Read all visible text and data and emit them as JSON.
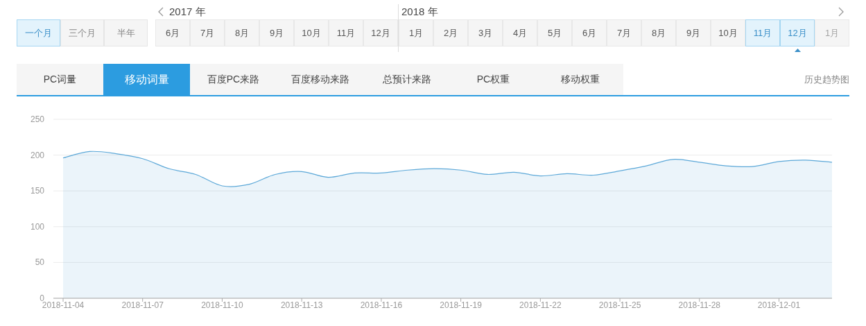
{
  "periods": [
    {
      "label": "一个月",
      "selected": true
    },
    {
      "label": "三个月",
      "selected": false
    },
    {
      "label": "半年",
      "selected": false
    }
  ],
  "year_groups": [
    {
      "year": "2017 年",
      "months": [
        {
          "label": "6月",
          "selected": false,
          "disabled": false
        },
        {
          "label": "7月",
          "selected": false,
          "disabled": false
        },
        {
          "label": "8月",
          "selected": false,
          "disabled": false
        },
        {
          "label": "9月",
          "selected": false,
          "disabled": false
        },
        {
          "label": "10月",
          "selected": false,
          "disabled": false
        },
        {
          "label": "11月",
          "selected": false,
          "disabled": false
        },
        {
          "label": "12月",
          "selected": false,
          "disabled": false
        }
      ]
    },
    {
      "year": "2018 年",
      "months": [
        {
          "label": "1月",
          "selected": false,
          "disabled": false
        },
        {
          "label": "2月",
          "selected": false,
          "disabled": false
        },
        {
          "label": "3月",
          "selected": false,
          "disabled": false
        },
        {
          "label": "4月",
          "selected": false,
          "disabled": false
        },
        {
          "label": "5月",
          "selected": false,
          "disabled": false
        },
        {
          "label": "6月",
          "selected": false,
          "disabled": false
        },
        {
          "label": "7月",
          "selected": false,
          "disabled": false
        },
        {
          "label": "8月",
          "selected": false,
          "disabled": false
        },
        {
          "label": "9月",
          "selected": false,
          "disabled": false
        },
        {
          "label": "10月",
          "selected": false,
          "disabled": false
        },
        {
          "label": "11月",
          "selected": true,
          "disabled": false
        },
        {
          "label": "12月",
          "selected": true,
          "disabled": false
        },
        {
          "label": "1月",
          "selected": false,
          "disabled": true
        }
      ]
    }
  ],
  "tabs": [
    {
      "label": "PC词量",
      "selected": false
    },
    {
      "label": "移动词量",
      "selected": true
    },
    {
      "label": "百度PC来路",
      "selected": false
    },
    {
      "label": "百度移动来路",
      "selected": false
    },
    {
      "label": "总预计来路",
      "selected": false
    },
    {
      "label": "PC权重",
      "selected": false
    },
    {
      "label": "移动权重",
      "selected": false
    }
  ],
  "history_link": "历史趋势图",
  "chart_data": {
    "type": "area",
    "x": [
      "2018-11-04",
      "2018-11-05",
      "2018-11-06",
      "2018-11-07",
      "2018-11-08",
      "2018-11-09",
      "2018-11-10",
      "2018-11-11",
      "2018-11-12",
      "2018-11-13",
      "2018-11-14",
      "2018-11-15",
      "2018-11-16",
      "2018-11-17",
      "2018-11-18",
      "2018-11-19",
      "2018-11-20",
      "2018-11-21",
      "2018-11-22",
      "2018-11-23",
      "2018-11-24",
      "2018-11-25",
      "2018-11-26",
      "2018-11-27",
      "2018-11-28",
      "2018-11-29",
      "2018-11-30",
      "2018-12-01",
      "2018-12-02",
      "2018-12-03"
    ],
    "series": [
      {
        "color": "#5ca8d8",
        "values": [
          196,
          205,
          202,
          195,
          181,
          173,
          157,
          159,
          173,
          177,
          169,
          175,
          175,
          179,
          181,
          179,
          173,
          176,
          171,
          174,
          172,
          178,
          185,
          194,
          190,
          185,
          184,
          191,
          193,
          190
        ]
      }
    ],
    "xlim": [
      "2018-11-04",
      "2018-12-03"
    ],
    "ylim": [
      0,
      250
    ],
    "grid": true,
    "yticks": [
      0,
      50,
      100,
      150,
      200,
      250
    ],
    "xticks": [
      "2018-11-04",
      "2018-11-07",
      "2018-11-10",
      "2018-11-13",
      "2018-11-16",
      "2018-11-19",
      "2018-11-22",
      "2018-11-25",
      "2018-11-28",
      "2018-12-01"
    ]
  }
}
